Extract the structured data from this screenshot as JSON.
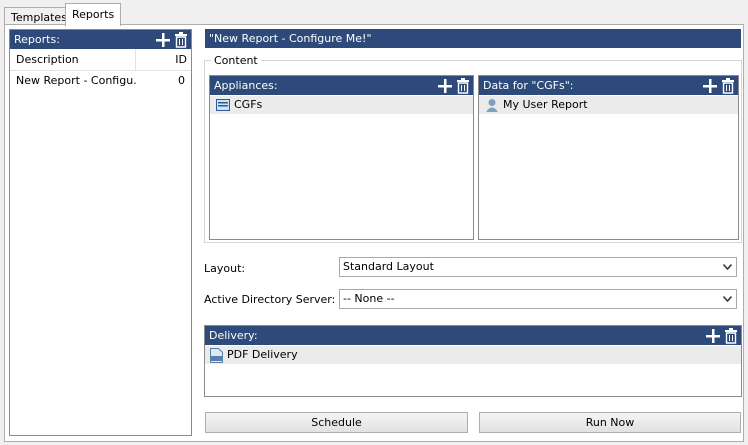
{
  "tabs": [
    {
      "label": "Templates"
    },
    {
      "label": "Reports"
    }
  ],
  "reports_panel": {
    "header": "Reports:",
    "columns": {
      "description": "Description",
      "id": "ID"
    },
    "rows": [
      {
        "description": "New Report - Configu...",
        "id": "0"
      }
    ]
  },
  "report_title": "\"New Report - Configure Me!\"",
  "content": {
    "group_label": "Content",
    "appliances": {
      "header": "Appliances:",
      "items": [
        {
          "label": "CGFs",
          "icon": "appliance-icon"
        }
      ]
    },
    "data_for": {
      "header": "Data for \"CGFs\":",
      "items": [
        {
          "label": "My User Report",
          "icon": "user-icon"
        }
      ]
    }
  },
  "layout_field": {
    "label": "Layout:",
    "value": "Standard Layout"
  },
  "ad_field": {
    "label": "Active Directory Server:",
    "value": "-- None --"
  },
  "delivery": {
    "header": "Delivery:",
    "items": [
      {
        "label": "PDF Delivery",
        "icon": "pdf-icon"
      }
    ]
  },
  "buttons": {
    "schedule": "Schedule",
    "run_now": "Run Now"
  },
  "colors": {
    "header_bg": "#2d4a7a",
    "selected_row": "#ebebeb"
  }
}
